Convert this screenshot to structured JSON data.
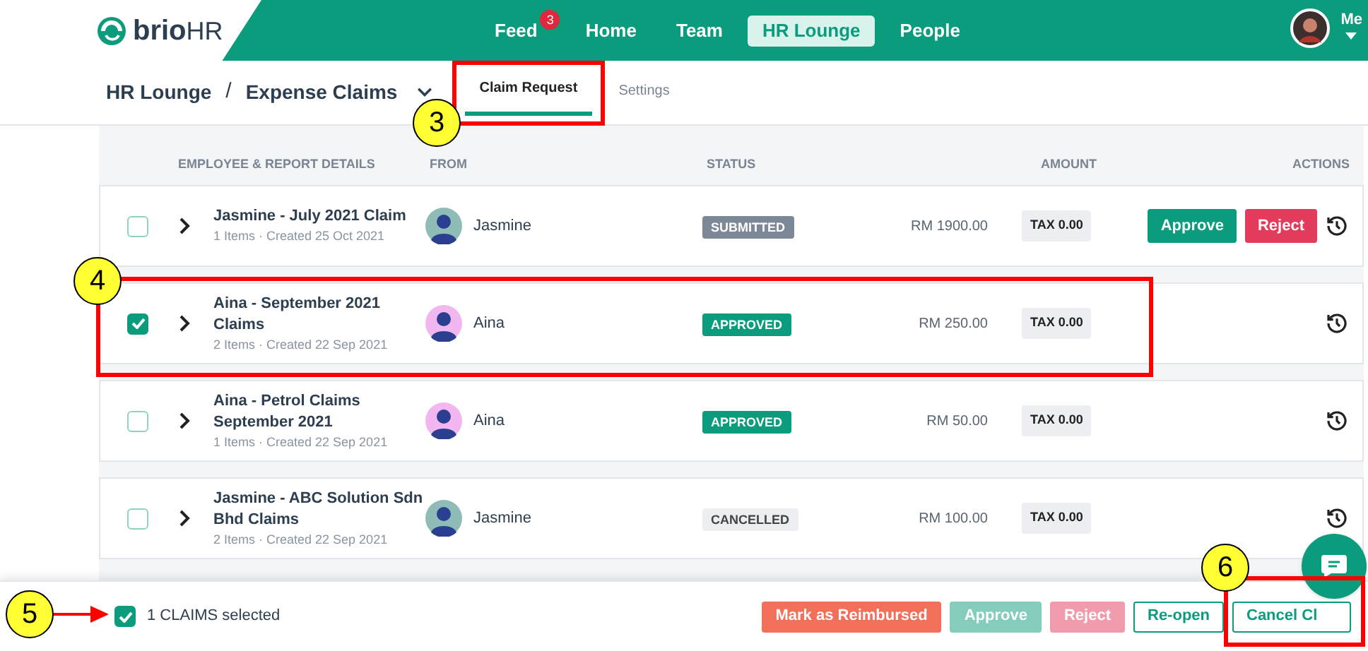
{
  "logo": {
    "text": "brio",
    "accent": "HR"
  },
  "nav": [
    {
      "label": "Feed",
      "badge": "3",
      "selected": false
    },
    {
      "label": "Home",
      "selected": false
    },
    {
      "label": "Team",
      "selected": false
    },
    {
      "label": "HR Lounge",
      "selected": true
    },
    {
      "label": "People",
      "selected": false
    }
  ],
  "user": {
    "label": "Me"
  },
  "breadcrumb": {
    "parent": "HR Lounge",
    "separator": "/",
    "current": "Expense Claims"
  },
  "tabs": [
    {
      "label": "Claim Request",
      "selected": true
    },
    {
      "label": "Settings",
      "selected": false
    }
  ],
  "table": {
    "columns": [
      "EMPLOYEE & REPORT DETAILS",
      "FROM",
      "STATUS",
      "AMOUNT",
      "ACTIONS"
    ],
    "rows": [
      {
        "checked": false,
        "title": "Jasmine - July 2021 Claim",
        "meta": "1 Items · Created 25 Oct 2021",
        "from": "Jasmine",
        "color": "#8fbcb6",
        "status": {
          "label": "SUBMITTED",
          "kind": "submitted"
        },
        "amount": "RM 1900.00",
        "tax": "TAX 0.00",
        "actions": [
          {
            "label": "Approve",
            "kind": "approve"
          },
          {
            "label": "Reject",
            "kind": "reject"
          }
        ]
      },
      {
        "checked": true,
        "title": "Aina - September 2021 Claims",
        "meta": "2 Items · Created 22 Sep 2021",
        "from": "Aina",
        "color": "#f2b6f0",
        "status": {
          "label": "APPROVED",
          "kind": "approved"
        },
        "amount": "RM 250.00",
        "tax": "TAX 0.00"
      },
      {
        "checked": false,
        "title": "Aina - Petrol Claims September 2021",
        "meta": "1 Items · Created 22 Sep 2021",
        "from": "Aina",
        "color": "#f2b6f0",
        "status": {
          "label": "APPROVED",
          "kind": "approved"
        },
        "amount": "RM 50.00",
        "tax": "TAX 0.00"
      },
      {
        "checked": false,
        "title": "Jasmine - ABC Solution Sdn Bhd Claims",
        "meta": "2 Items · Created 22 Sep 2021",
        "from": "Jasmine",
        "color": "#8fbcb6",
        "status": {
          "label": "CANCELLED",
          "kind": "cancelled"
        },
        "amount": "RM 100.00",
        "tax": "TAX 0.00"
      }
    ]
  },
  "selection": {
    "checked": true,
    "label": "1 CLAIMS selected"
  },
  "bulk_actions": [
    {
      "label": "Mark as Reimbursed",
      "kind": "reimburse",
      "disabled": false
    },
    {
      "label": "Approve",
      "kind": "approve",
      "disabled": true
    },
    {
      "label": "Reject",
      "kind": "reject",
      "disabled": true
    },
    {
      "label": "Re-open",
      "kind": "outline",
      "disabled": false
    },
    {
      "label": "Cancel Cl",
      "kind": "outline",
      "disabled": false
    }
  ],
  "callouts": [
    {
      "label": "3"
    },
    {
      "label": "4"
    },
    {
      "label": "5"
    },
    {
      "label": "6"
    }
  ]
}
